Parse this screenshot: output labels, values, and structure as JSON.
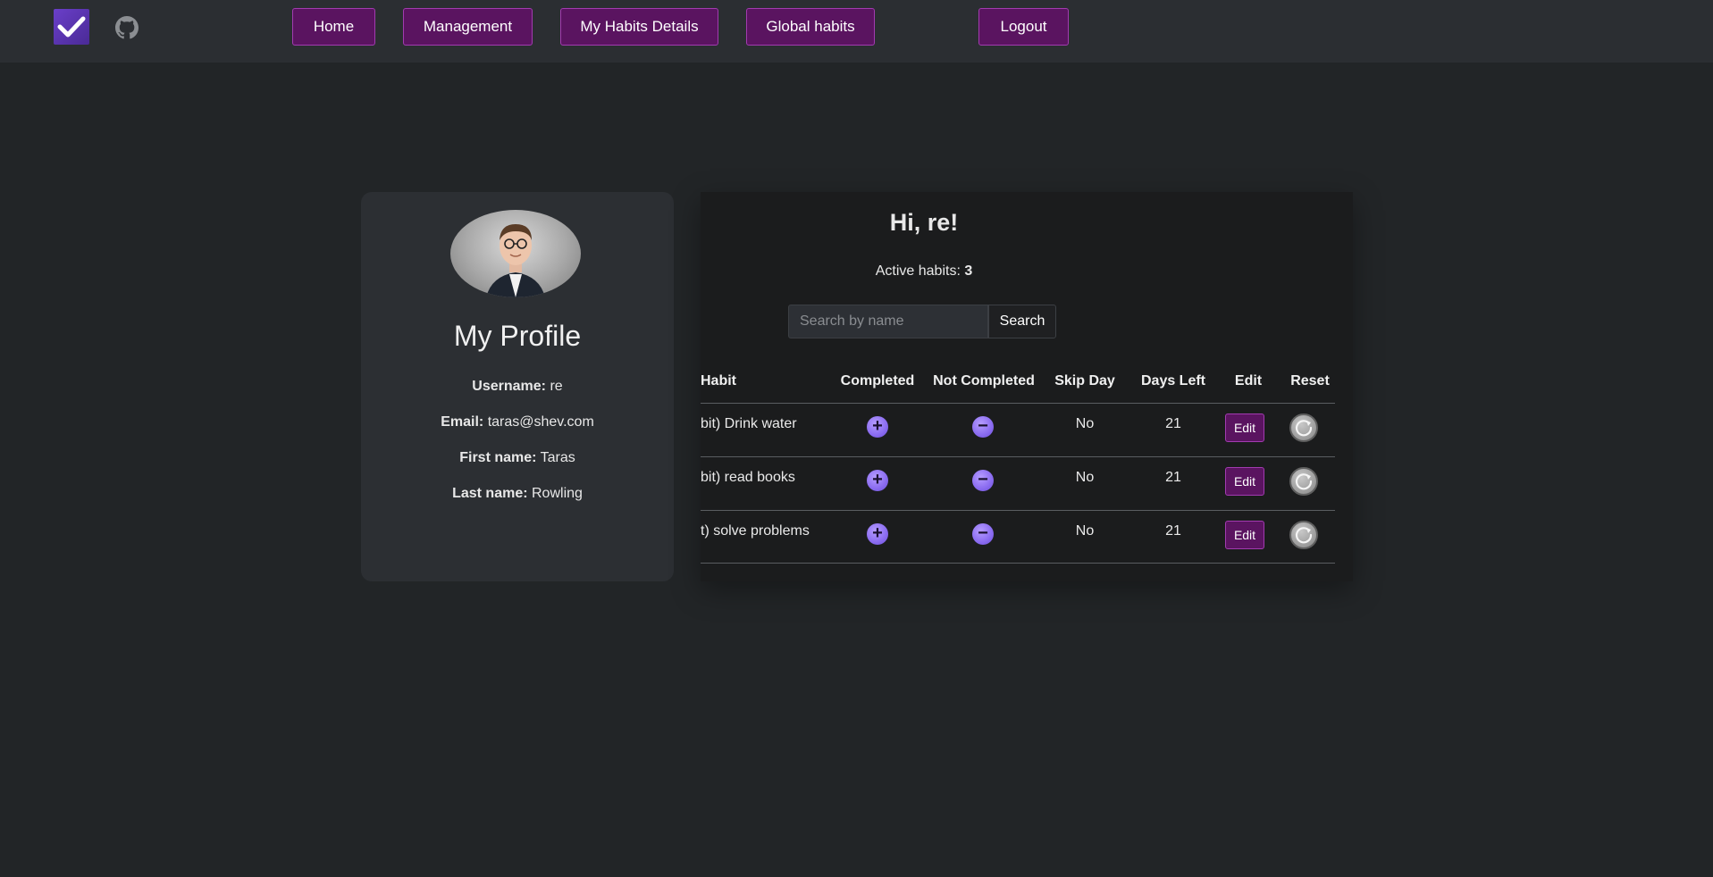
{
  "nav": {
    "home": "Home",
    "management": "Management",
    "my_habits_details": "My Habits Details",
    "global_habits": "Global habits",
    "logout": "Logout",
    "logo_icon": "checkmark-icon",
    "github_icon": "github-icon"
  },
  "profile": {
    "title": "My Profile",
    "username_label": "Username:",
    "username": "re",
    "email_label": "Email:",
    "email": "taras@shev.com",
    "first_name_label": "First name:",
    "first_name": "Taras",
    "last_name_label": "Last name:",
    "last_name": "Rowling"
  },
  "habits": {
    "greeting": "Hi, re!",
    "active_label": "Active habits:",
    "active_count": "3",
    "search_placeholder": "Search by name",
    "search_button": "Search",
    "columns": [
      "Habit",
      "Completed",
      "Not Completed",
      "Skip Day",
      "Days Left",
      "Edit",
      "Reset"
    ],
    "rows": [
      {
        "name": "bit) Drink water",
        "skip_day": "No",
        "days_left": "21",
        "edit": "Edit"
      },
      {
        "name": "bit) read books",
        "skip_day": "No",
        "days_left": "21",
        "edit": "Edit"
      },
      {
        "name": "t) solve problems",
        "skip_day": "No",
        "days_left": "21",
        "edit": "Edit"
      }
    ]
  },
  "colors": {
    "background": "#222527",
    "navbar": "#2b2e32",
    "button_purple": "#5a1460",
    "accent_violet": "#8a6bf0",
    "card": "#2c2f33",
    "panel": "#1b1c1d"
  }
}
